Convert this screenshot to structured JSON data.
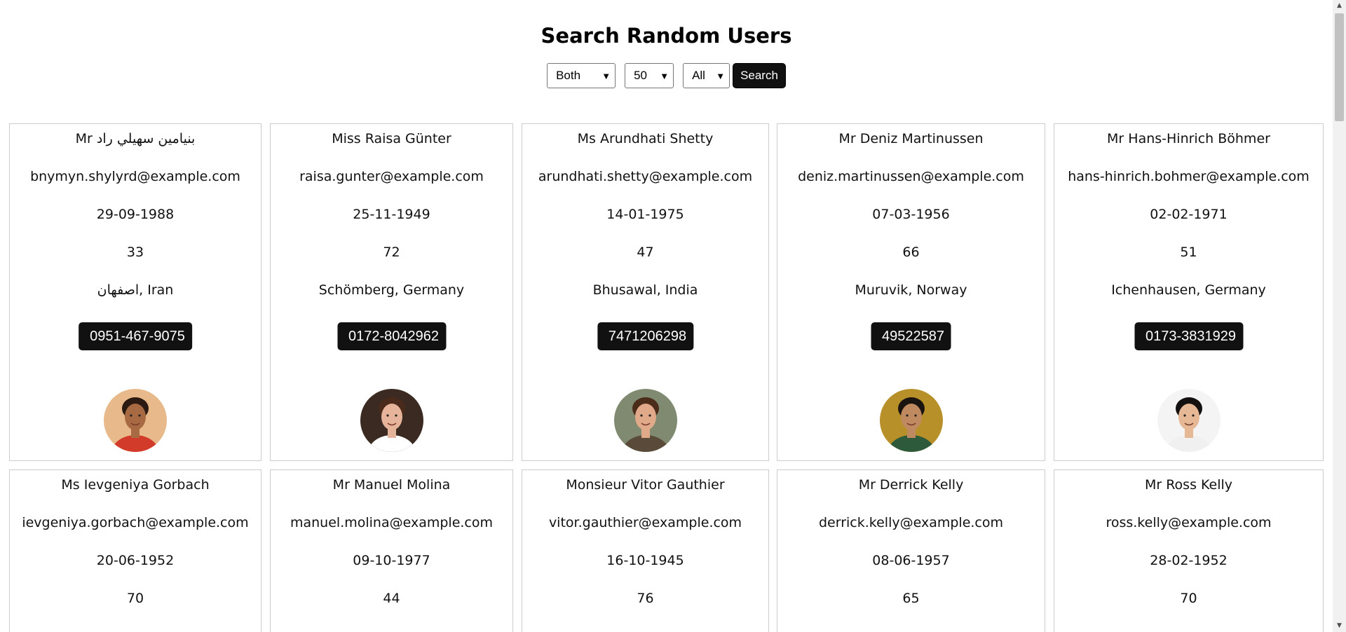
{
  "header": {
    "title": "Search Random Users"
  },
  "controls": {
    "gender_select": "Both",
    "count_select": "50",
    "nationality_select": "All",
    "search_button": "Search",
    "chevron_glyph": "⌄"
  },
  "phone_icon_glyph": "",
  "users": [
    {
      "name": "Mr بنیامین سهيلي راد",
      "email": "bnymyn.shylyrd@example.com",
      "dob": "29-09-1988",
      "age": "33",
      "location": "اصفهان, Iran",
      "phone": "0951-467-9075",
      "avatar": {
        "bg": "#e8b98a",
        "skin": "#a86a43",
        "hair": "#2a1a12",
        "shirt": "#d23a2a"
      }
    },
    {
      "name": "Miss Raisa Günter",
      "email": "raisa.gunter@example.com",
      "dob": "25-11-1949",
      "age": "72",
      "location": "Schömberg, Germany",
      "phone": "0172-8042962",
      "avatar": {
        "bg": "#3a2a22",
        "skin": "#e6b49a",
        "hair": "#4a2a1a",
        "shirt": "#ffffff"
      }
    },
    {
      "name": "Ms Arundhati Shetty",
      "email": "arundhati.shetty@example.com",
      "dob": "14-01-1975",
      "age": "47",
      "location": "Bhusawal, India",
      "phone": "7471206298",
      "avatar": {
        "bg": "#7f8a70",
        "skin": "#e0a98a",
        "hair": "#4b2b1a",
        "shirt": "#5a4a3a"
      }
    },
    {
      "name": "Mr Deniz Martinussen",
      "email": "deniz.martinussen@example.com",
      "dob": "07-03-1956",
      "age": "66",
      "location": "Muruvik, Norway",
      "phone": "49522587",
      "avatar": {
        "bg": "#b8902a",
        "skin": "#c08a60",
        "hair": "#1a1410",
        "shirt": "#2d5a3a"
      }
    },
    {
      "name": "Mr Hans-Hinrich Böhmer",
      "email": "hans-hinrich.bohmer@example.com",
      "dob": "02-02-1971",
      "age": "51",
      "location": "Ichenhausen, Germany",
      "phone": "0173-3831929",
      "avatar": {
        "bg": "#f4f4f4",
        "skin": "#e6b896",
        "hair": "#141010",
        "shirt": "#f0f0f0"
      }
    },
    {
      "name": "Ms Ievgeniya Gorbach",
      "email": "ievgeniya.gorbach@example.com",
      "dob": "20-06-1952",
      "age": "70"
    },
    {
      "name": "Mr Manuel Molina",
      "email": "manuel.molina@example.com",
      "dob": "09-10-1977",
      "age": "44"
    },
    {
      "name": "Monsieur Vitor Gauthier",
      "email": "vitor.gauthier@example.com",
      "dob": "16-10-1945",
      "age": "76"
    },
    {
      "name": "Mr Derrick Kelly",
      "email": "derrick.kelly@example.com",
      "dob": "08-06-1957",
      "age": "65"
    },
    {
      "name": "Mr Ross Kelly",
      "email": "ross.kelly@example.com",
      "dob": "28-02-1952",
      "age": "70"
    }
  ]
}
